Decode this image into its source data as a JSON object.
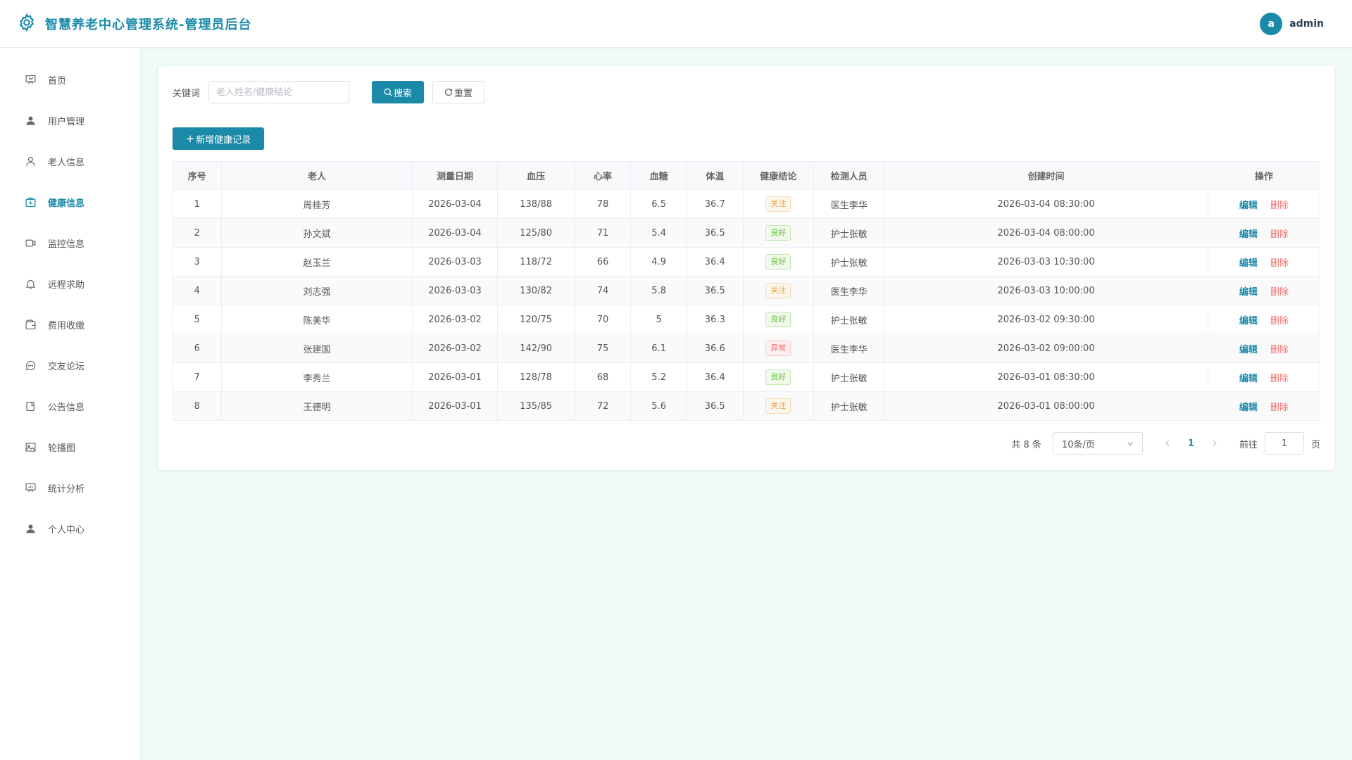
{
  "app": {
    "title": "智慧养老中心管理系统-管理员后台",
    "brand_color": "#1a8aa8"
  },
  "user": {
    "avatar_letter": "a",
    "name": "admin"
  },
  "sidebar": {
    "items": [
      {
        "label": "首页",
        "icon": "presentation-icon"
      },
      {
        "label": "用户管理",
        "icon": "user-filled-icon"
      },
      {
        "label": "老人信息",
        "icon": "user-outline-icon"
      },
      {
        "label": "健康信息",
        "icon": "first-aid-kit-icon",
        "active": true
      },
      {
        "label": "监控信息",
        "icon": "video-camera-icon"
      },
      {
        "label": "远程求助",
        "icon": "bell-icon"
      },
      {
        "label": "费用收缴",
        "icon": "wallet-icon"
      },
      {
        "label": "交友论坛",
        "icon": "chat-bubble-icon"
      },
      {
        "label": "公告信息",
        "icon": "notebook-icon"
      },
      {
        "label": "轮播图",
        "icon": "picture-icon"
      },
      {
        "label": "统计分析",
        "icon": "presentation-chart-icon"
      },
      {
        "label": "个人中心",
        "icon": "user-filled-icon"
      }
    ]
  },
  "search": {
    "label": "关键词",
    "placeholder": "老人姓名/健康结论",
    "value": "",
    "search_button": "搜索",
    "reset_button": "重置"
  },
  "add_button": "新增健康记录",
  "table": {
    "columns": [
      "序号",
      "老人",
      "测量日期",
      "血压",
      "心率",
      "血糖",
      "体温",
      "健康结论",
      "检测人员",
      "创建时间",
      "操作"
    ],
    "edit_label": "编辑",
    "delete_label": "删除",
    "rows": [
      {
        "no": "1",
        "name": "周桂芳",
        "date": "2026-03-04",
        "bp": "138/88",
        "hr": "78",
        "sugar": "6.5",
        "temp": "36.7",
        "conclusion": "关注",
        "status": "warn",
        "inspector": "医生李华",
        "created": "2026-03-04 08:30:00"
      },
      {
        "no": "2",
        "name": "孙文斌",
        "date": "2026-03-04",
        "bp": "125/80",
        "hr": "71",
        "sugar": "5.4",
        "temp": "36.5",
        "conclusion": "良好",
        "status": "good",
        "inspector": "护士张敏",
        "created": "2026-03-04 08:00:00"
      },
      {
        "no": "3",
        "name": "赵玉兰",
        "date": "2026-03-03",
        "bp": "118/72",
        "hr": "66",
        "sugar": "4.9",
        "temp": "36.4",
        "conclusion": "良好",
        "status": "good",
        "inspector": "护士张敏",
        "created": "2026-03-03 10:30:00"
      },
      {
        "no": "4",
        "name": "刘志强",
        "date": "2026-03-03",
        "bp": "130/82",
        "hr": "74",
        "sugar": "5.8",
        "temp": "36.5",
        "conclusion": "关注",
        "status": "warn",
        "inspector": "医生李华",
        "created": "2026-03-03 10:00:00"
      },
      {
        "no": "5",
        "name": "陈美华",
        "date": "2026-03-02",
        "bp": "120/75",
        "hr": "70",
        "sugar": "5",
        "temp": "36.3",
        "conclusion": "良好",
        "status": "good",
        "inspector": "护士张敏",
        "created": "2026-03-02 09:30:00"
      },
      {
        "no": "6",
        "name": "张建国",
        "date": "2026-03-02",
        "bp": "142/90",
        "hr": "75",
        "sugar": "6.1",
        "temp": "36.6",
        "conclusion": "异常",
        "status": "bad",
        "inspector": "医生李华",
        "created": "2026-03-02 09:00:00"
      },
      {
        "no": "7",
        "name": "李秀兰",
        "date": "2026-03-01",
        "bp": "128/78",
        "hr": "68",
        "sugar": "5.2",
        "temp": "36.4",
        "conclusion": "良好",
        "status": "good",
        "inspector": "护士张敏",
        "created": "2026-03-01 08:30:00"
      },
      {
        "no": "8",
        "name": "王德明",
        "date": "2026-03-01",
        "bp": "135/85",
        "hr": "72",
        "sugar": "5.6",
        "temp": "36.5",
        "conclusion": "关注",
        "status": "warn",
        "inspector": "护士张敏",
        "created": "2026-03-01 08:00:00"
      }
    ]
  },
  "pagination": {
    "total_text": "共 8 条",
    "page_size": "10条/页",
    "current_page": "1",
    "goto_label": "前往",
    "goto_value": "1",
    "page_suffix": "页"
  }
}
